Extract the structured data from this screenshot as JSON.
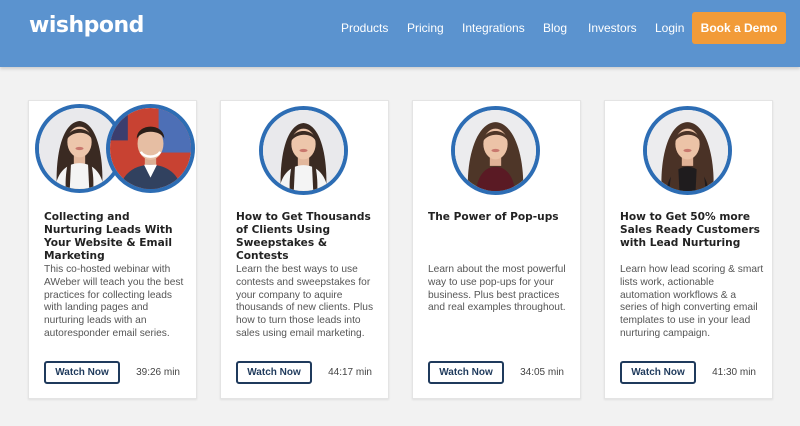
{
  "header": {
    "logo": "wishpond",
    "nav": [
      "Products",
      "Pricing",
      "Integrations",
      "Blog",
      "Investors",
      "Login"
    ],
    "cta": "Book a Demo"
  },
  "cards": [
    {
      "title": "Collecting and Nurturing Leads With Your Website & Email Marketing",
      "description": "This co-hosted webinar with AWeber will teach you the best practices for collecting leads with landing pages and nurturing leads with an autoresponder email series.",
      "button": "Watch Now",
      "duration": "39:26 min"
    },
    {
      "title": "How to Get Thousands of Clients Using Sweepstakes & Contests",
      "description": "Learn the best ways to use contests and sweepstakes for your company to aquire thousands of new clients. Plus how to turn those leads into sales using email marketing.",
      "button": "Watch Now",
      "duration": "44:17 min"
    },
    {
      "title": "The Power of Pop-ups",
      "description": "Learn about the most powerful way to use pop-ups for your business. Plus best practices and real examples throughout.",
      "button": "Watch Now",
      "duration": "34:05 min"
    },
    {
      "title": "How to Get 50% more Sales Ready Customers with Lead Nurturing",
      "description": "Learn how lead scoring & smart lists work, actionable automation workflows & a series of high converting email templates to use in your lead nurturing campaign.",
      "button": "Watch Now",
      "duration": "41:30 min"
    }
  ],
  "colors": {
    "header_bg": "#5b93cf",
    "cta_bg": "#f29b38",
    "avatar_ring": "#2d6db4",
    "button_border": "#1f3a5c"
  }
}
